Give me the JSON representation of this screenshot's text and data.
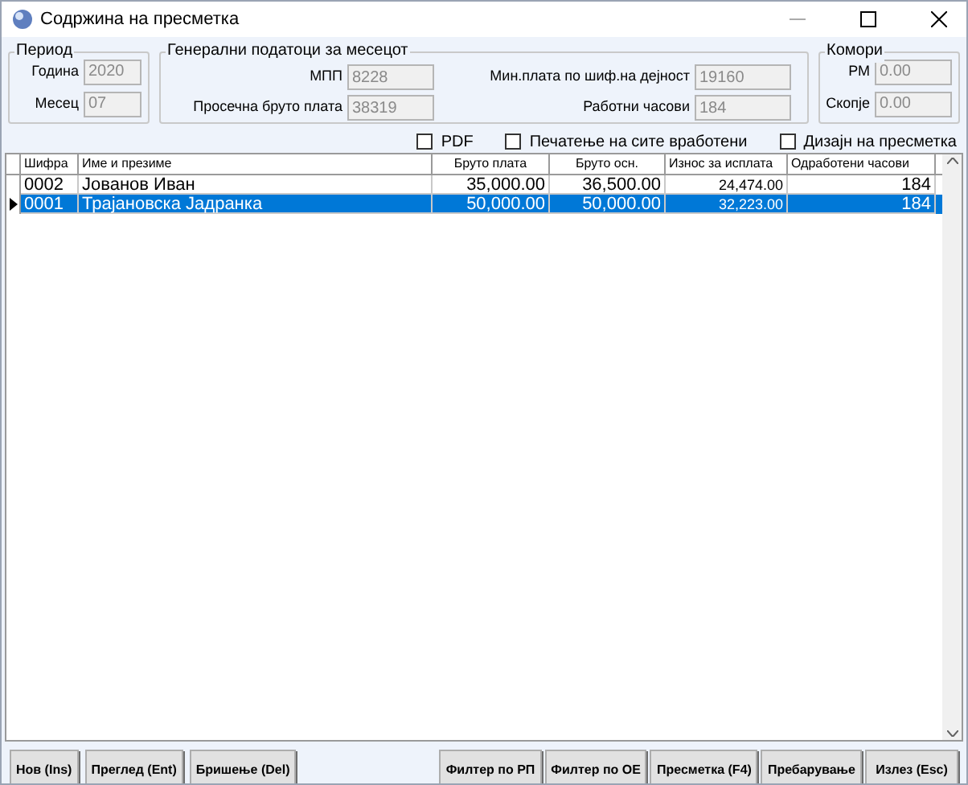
{
  "window": {
    "title": "Содржина на пресметка"
  },
  "period": {
    "title": "Период",
    "fields": [
      {
        "label": "Година",
        "value": "2020"
      },
      {
        "label": "Месец",
        "value": "07"
      }
    ]
  },
  "general": {
    "title": "Генерални податоци за месецот",
    "fields": [
      {
        "label": "МПП",
        "value": "8228"
      },
      {
        "label": "Мин.плата по шиф.на дејност",
        "value": "19160"
      },
      {
        "label": "Просечна бруто плата",
        "value": "38319"
      },
      {
        "label": "Работни часови",
        "value": "184"
      }
    ]
  },
  "chambers": {
    "title": "Комори",
    "fields": [
      {
        "label": "РМ",
        "value": "0.00"
      },
      {
        "label": "Скопје",
        "value": "0.00"
      }
    ]
  },
  "options": [
    {
      "label": "PDF",
      "checked": false
    },
    {
      "label": "Печатење на сите вработени",
      "checked": false
    },
    {
      "label": "Дизајн на пресметка",
      "checked": false
    }
  ],
  "table": {
    "columns": [
      "Шифра",
      "Име и презиме",
      "Бруто плата",
      "Бруто осн.",
      "Износ за исплата",
      "Одработени часови"
    ],
    "rows": [
      {
        "cells": [
          "0002",
          "Јованов Иван",
          "35,000.00",
          "36,500.00",
          "24,474.00",
          "184"
        ],
        "selected": false
      },
      {
        "cells": [
          "0001",
          "Трајановска Јадранка",
          "50,000.00",
          "50,000.00",
          "32,223.00",
          "184"
        ],
        "selected": true
      }
    ]
  },
  "buttons_left": [
    "Нов (Ins)",
    "Преглед (Ent)",
    "Бришење (Del)"
  ],
  "buttons_right": [
    "Филтер по РП",
    "Филтер по ОЕ",
    "Пресметка (F4)",
    "Пребарување",
    "Излез (Esc)"
  ]
}
